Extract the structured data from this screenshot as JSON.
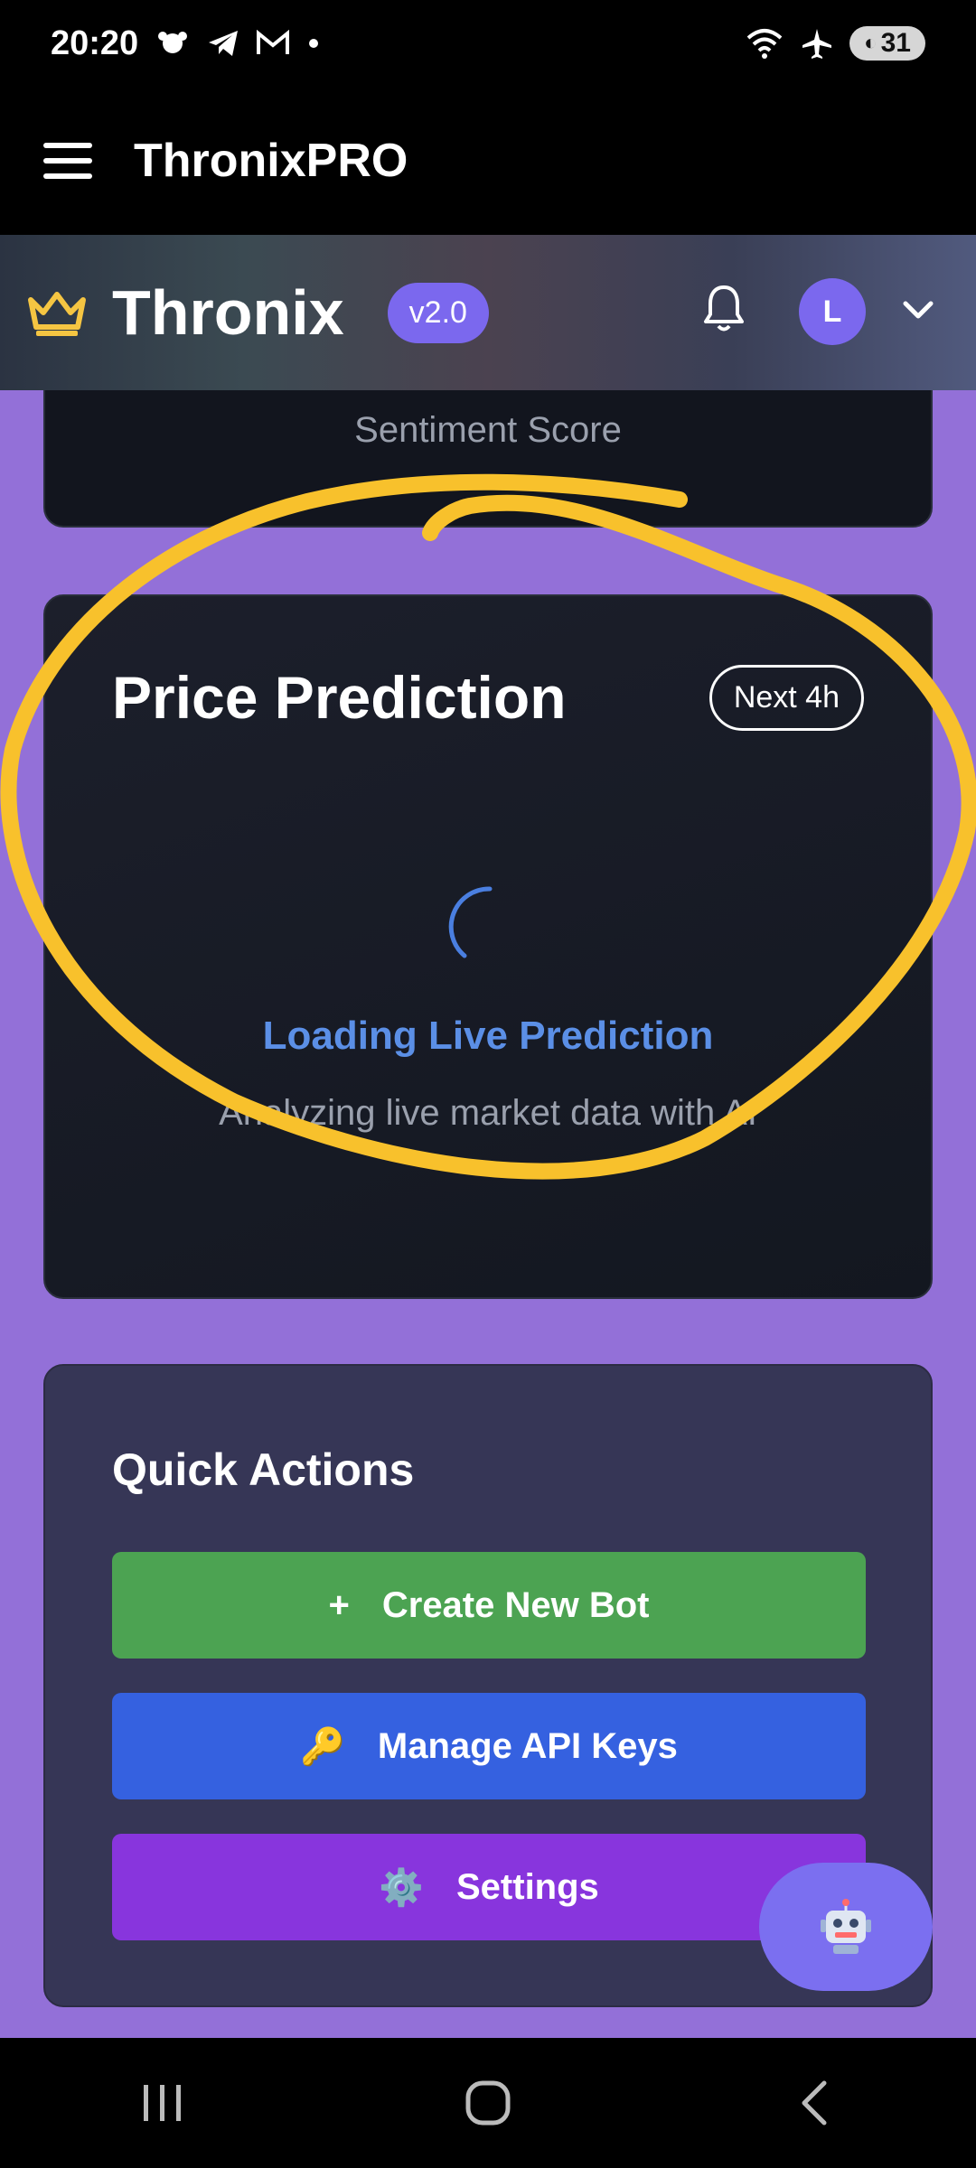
{
  "status_bar": {
    "time": "20:20",
    "battery": "31"
  },
  "app_bar": {
    "title": "ThronixPRO"
  },
  "site_header": {
    "brand": "Thronix",
    "version": "v2.0",
    "avatar_initial": "L",
    "accent_color": "#7b68ee"
  },
  "sentiment_card": {
    "label": "Sentiment Score"
  },
  "prediction_card": {
    "title": "Price Prediction",
    "timeframe": "Next 4h",
    "loading_title": "Loading Live Prediction",
    "loading_subtitle": "Analyzing live market data with AI"
  },
  "quick_actions": {
    "title": "Quick Actions",
    "buttons": [
      {
        "label": "Create New Bot",
        "icon": "+",
        "color": "#4ca352"
      },
      {
        "label": "Manage API Keys",
        "icon": "🔑",
        "color": "#3561e0"
      },
      {
        "label": "Settings",
        "icon": "⚙️",
        "color": "#8835dd"
      }
    ]
  },
  "fab": {
    "icon": "🤖"
  },
  "colors": {
    "page_background": "#9370d8",
    "annotation": "#f8c12c"
  }
}
